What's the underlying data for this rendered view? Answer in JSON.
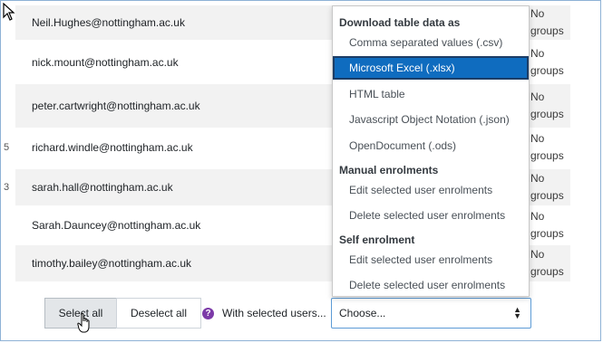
{
  "rows": [
    {
      "lead": "",
      "email": "Neil.Hughes@nottingham.ac.uk",
      "groups": "No groups"
    },
    {
      "lead": "",
      "email": "nick.mount@nottingham.ac.uk",
      "groups": "No groups"
    },
    {
      "lead": "",
      "email": "peter.cartwright@nottingham.ac.uk",
      "groups": "No groups"
    },
    {
      "lead": "5",
      "email": "richard.windle@nottingham.ac.uk",
      "groups": "No groups"
    },
    {
      "lead": "3",
      "email": "sarah.hall@nottingham.ac.uk",
      "groups": "No groups"
    },
    {
      "lead": "",
      "email": "Sarah.Dauncey@nottingham.ac.uk",
      "groups": "No groups"
    },
    {
      "lead": "",
      "email": "timothy.bailey@nottingham.ac.uk",
      "groups": "No groups"
    }
  ],
  "dropdown": {
    "sections": [
      {
        "header": "Download table data as",
        "items": [
          "Comma separated values (.csv)",
          "Microsoft Excel (.xlsx)",
          "HTML table",
          "Javascript Object Notation (.json)",
          "OpenDocument (.ods)"
        ]
      },
      {
        "header": "Manual enrolments",
        "items": [
          "Edit selected user enrolments",
          "Delete selected user enrolments"
        ]
      },
      {
        "header": "Self enrolment",
        "items": [
          "Edit selected user enrolments",
          "Delete selected user enrolments"
        ]
      }
    ],
    "highlighted": "Microsoft Excel (.xlsx)"
  },
  "footer": {
    "select_all": "Select all",
    "deselect_all": "Deselect all",
    "help_glyph": "?",
    "with_selected": "With selected users...",
    "choose": "Choose...",
    "choose_arrows": "▲▼"
  },
  "colors": {
    "highlight": "#0f6cbf",
    "help_icon": "#7c3aa8",
    "select_border": "#5c9bd6"
  }
}
